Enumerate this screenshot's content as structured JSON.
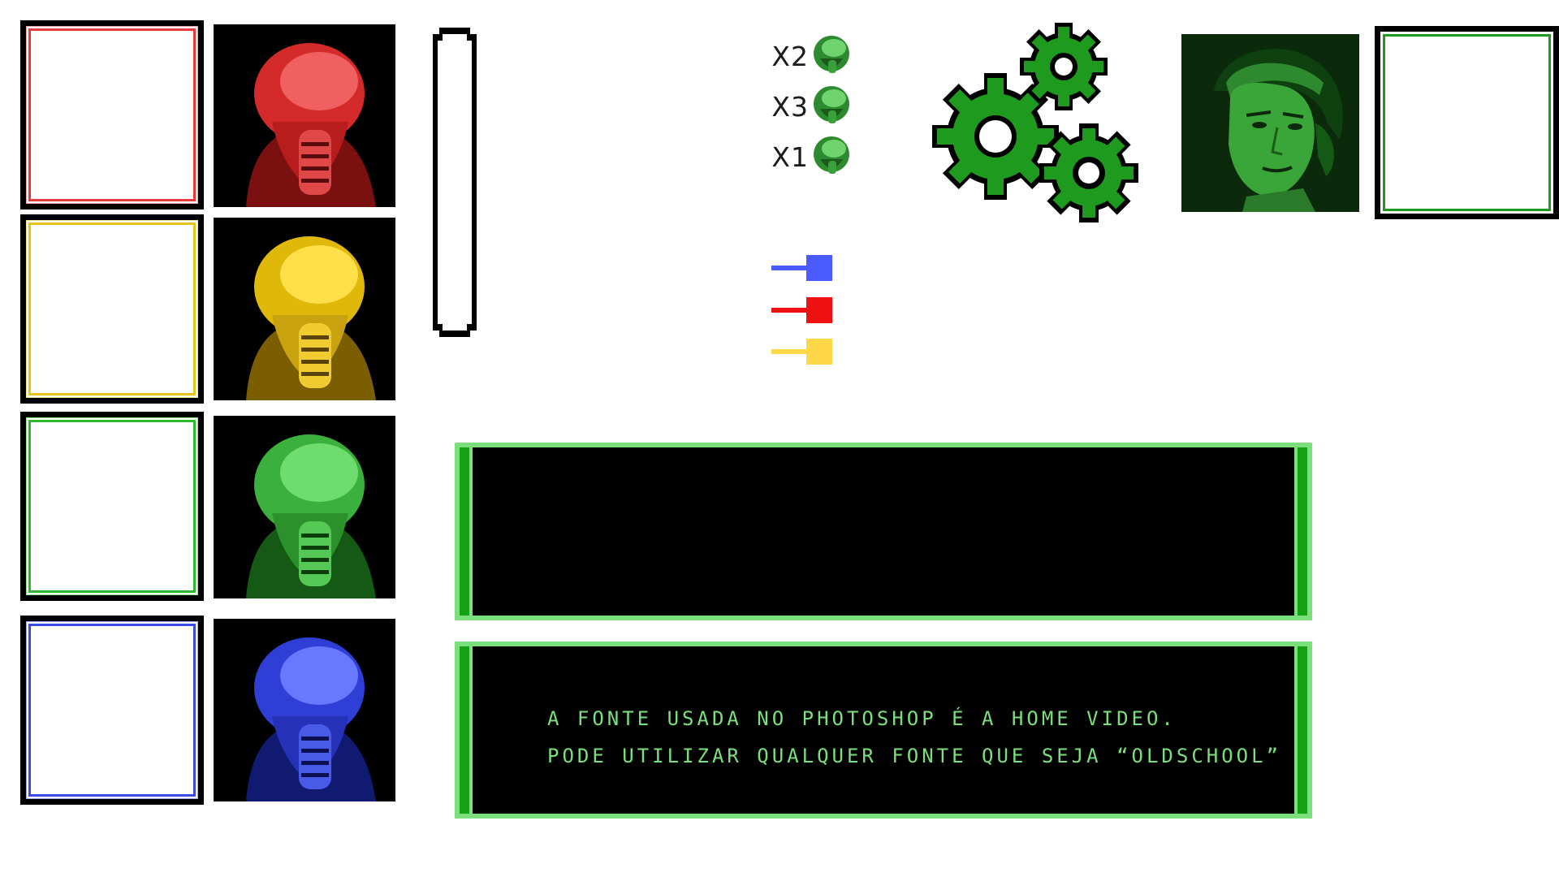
{
  "players": [
    {
      "slot": "player-1",
      "color": "#e83a3a",
      "helmet_color": "red"
    },
    {
      "slot": "player-2",
      "color": "#e8c21a",
      "helmet_color": "yellow"
    },
    {
      "slot": "player-3",
      "color": "#2fb82f",
      "helmet_color": "green"
    },
    {
      "slot": "player-4",
      "color": "#3a4be8",
      "helmet_color": "blue"
    }
  ],
  "lives": [
    {
      "label": "X2",
      "icon": "green-helmet-icon"
    },
    {
      "label": "X3",
      "icon": "green-helmet-icon"
    },
    {
      "label": "X1",
      "icon": "green-helmet-icon"
    }
  ],
  "color_keys": [
    {
      "color": "#4a5cff",
      "name": "blue-key"
    },
    {
      "color": "#ee1111",
      "name": "red-key"
    },
    {
      "color": "#ffd84a",
      "name": "yellow-key"
    }
  ],
  "settings": {
    "icon": "gears-icon"
  },
  "operator": {
    "icon": "operator-portrait",
    "tint": "#1f9a1f"
  },
  "dialogs": {
    "top": {
      "text": ""
    },
    "bottom": {
      "line1": "A FONTE USADA NO PHOTOSHOP É A HOME VIDEO.",
      "line2": "PODE UTILIZAR QUALQUER FONTE QUE SEJA “OLDSCHOOL”"
    }
  },
  "colors": {
    "dialog_frame": "#7be07b",
    "dialog_rim": "#16a016",
    "dialog_text": "#7be07b"
  }
}
